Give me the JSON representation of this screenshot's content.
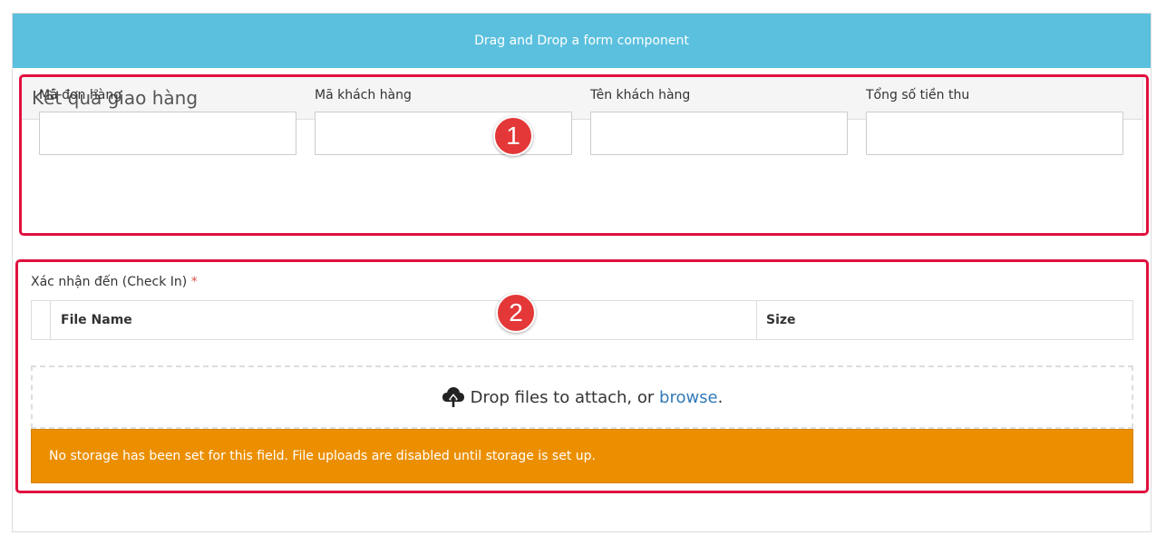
{
  "builder": {
    "drop_banner": "Drag and Drop a form component"
  },
  "panel": {
    "title": "Kết quả giao hàng",
    "fields": [
      {
        "label": "Mã đơn hàng",
        "value": ""
      },
      {
        "label": "Mã khách hàng",
        "value": ""
      },
      {
        "label": "Tên khách hàng",
        "value": ""
      },
      {
        "label": "Tổng số tiền thu",
        "value": ""
      }
    ]
  },
  "file_field": {
    "label": "Xác nhận đến (Check In)",
    "required_marker": "*",
    "columns": [
      "File Name",
      "Size"
    ],
    "dropzone": {
      "icon": "cloud-upload-icon",
      "text_before": "Drop files to attach, or ",
      "browse_link": "browse",
      "text_after": "."
    },
    "warning": "No storage has been set for this field. File uploads are disabled until storage is set up."
  },
  "annotations": {
    "badge_1": "1",
    "badge_2": "2",
    "highlight_color": "#e0103f",
    "badge_color": "#e43838"
  },
  "colors": {
    "banner": "#5bc0de",
    "warning": "#eb8f00",
    "link": "#337ab7"
  }
}
